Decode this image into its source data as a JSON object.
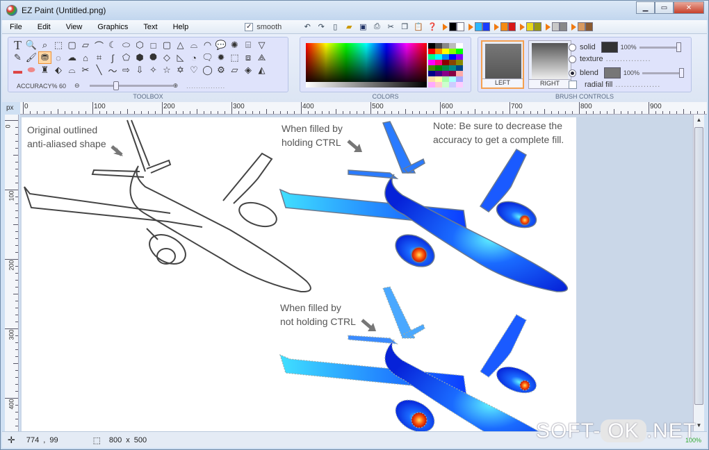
{
  "window": {
    "title": "EZ Paint (Untitled.png)"
  },
  "menu": [
    "File",
    "Edit",
    "View",
    "Graphics",
    "Text",
    "Help"
  ],
  "smooth": {
    "label": "smooth",
    "checked": true
  },
  "toolbox": {
    "label": "TOOLBOX",
    "accuracy_label": "ACCURACY% 60"
  },
  "colors": {
    "label": "COLORS"
  },
  "brush": {
    "label": "BRUSH CONTROLS",
    "left": "LEFT",
    "right": "RIGHT",
    "solid": "solid",
    "texture": "texture",
    "blend": "blend",
    "radial": "radial fill",
    "solid_pct": "100%",
    "blend_pct": "100%",
    "dots": "................"
  },
  "ruler": {
    "unit": "px",
    "h_ticks": [
      "0",
      "100",
      "200",
      "300",
      "400",
      "500",
      "600",
      "700",
      "800",
      "900"
    ],
    "v_ticks": [
      "0",
      "100",
      "200",
      "300",
      "400"
    ]
  },
  "canvas": {
    "note1": "Original outlined\nanti-aliased shape",
    "note2": "When filled by\nholding CTRL",
    "note3": "Note: Be sure to decrease the\naccuracy to get a complete fill.",
    "note4": "When filled by\nnot holding CTRL"
  },
  "status": {
    "cursor_x": "774",
    "cursor_sep": ",",
    "cursor_y": "99",
    "size_w": "800",
    "size_x": "x",
    "size_h": "500",
    "zoom": "100%"
  },
  "watermark": {
    "left": "SOFT-",
    "ok": "OK",
    "right": ".NET"
  },
  "colors_accent": {
    "orange": "#f07a10",
    "blue_fill": "#0a3cff",
    "cyan": "#28d8ff"
  }
}
